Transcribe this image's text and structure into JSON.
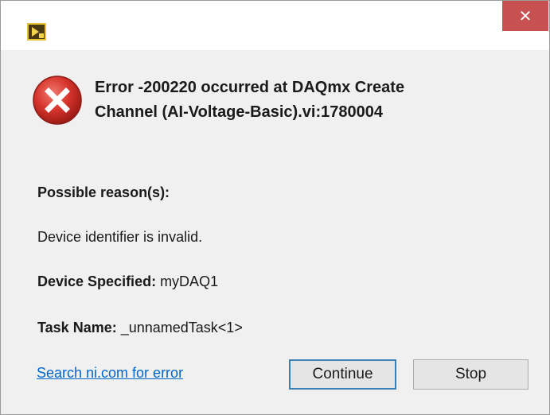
{
  "window": {
    "close_glyph": "✕"
  },
  "error": {
    "title_line1": "Error -200220 occurred at DAQmx Create",
    "title_line2": "Channel (AI-Voltage-Basic).vi:1780004"
  },
  "reason": {
    "heading": "Possible reason(s):",
    "text": "Device identifier is invalid."
  },
  "device": {
    "label": "Device Specified:",
    "value": " myDAQ1"
  },
  "task": {
    "label": "Task Name:",
    "value": " _unnamedTask<1>"
  },
  "actions": {
    "search_link": "Search ni.com for error",
    "continue_label": "Continue",
    "stop_label": "Stop"
  },
  "colors": {
    "close_button": "#c75050",
    "error_icon": "#d6342c",
    "link": "#0066cc",
    "default_button_border": "#3c7fb1"
  }
}
